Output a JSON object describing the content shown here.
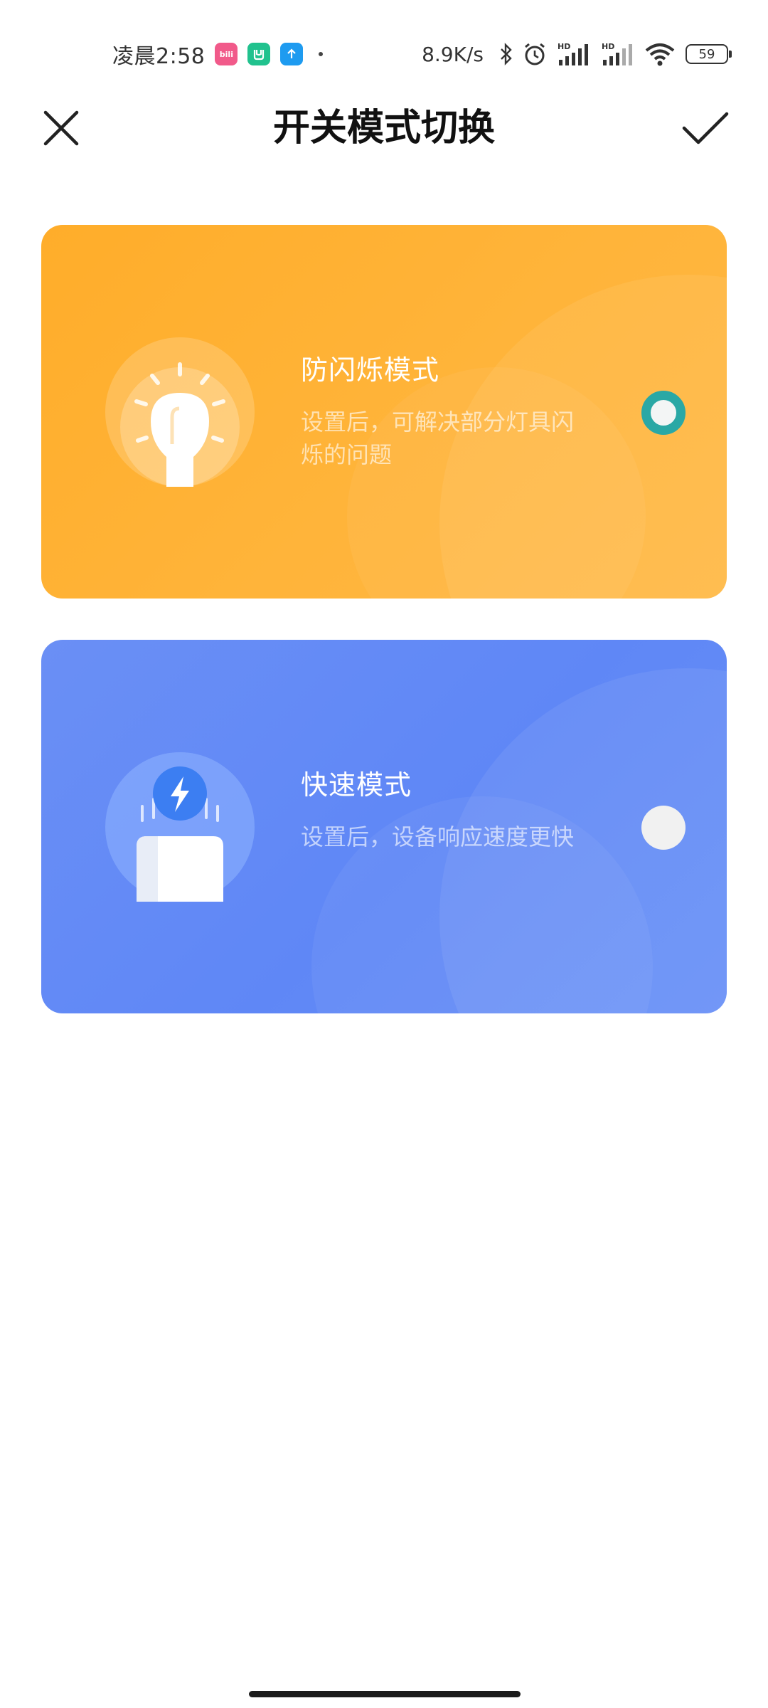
{
  "status_bar": {
    "time": "凌晨2:58",
    "app_icons": [
      "bilibili-icon",
      "mi-home-icon",
      "upload-icon"
    ],
    "network_speed": "8.9K/s",
    "battery_level": "59",
    "icons": [
      "bluetooth-icon",
      "alarm-icon",
      "hd-signal-icon",
      "hd-signal-icon",
      "wifi-icon",
      "battery-icon"
    ]
  },
  "header": {
    "title": "开关模式切换",
    "close_icon": "close-icon",
    "confirm_icon": "checkmark-icon"
  },
  "modes": [
    {
      "title": "防闪烁模式",
      "description": "设置后，可解决部分灯具闪烁的问题",
      "selected": true,
      "color": "#FFB033",
      "icon": "light-bulb-icon"
    },
    {
      "title": "快速模式",
      "description": "设置后，设备响应速度更快",
      "selected": false,
      "color": "#648BF6",
      "icon": "lightning-icon"
    }
  ],
  "colors": {
    "radio_selected": "#2AA8A5",
    "background": "#FFFFFF"
  }
}
